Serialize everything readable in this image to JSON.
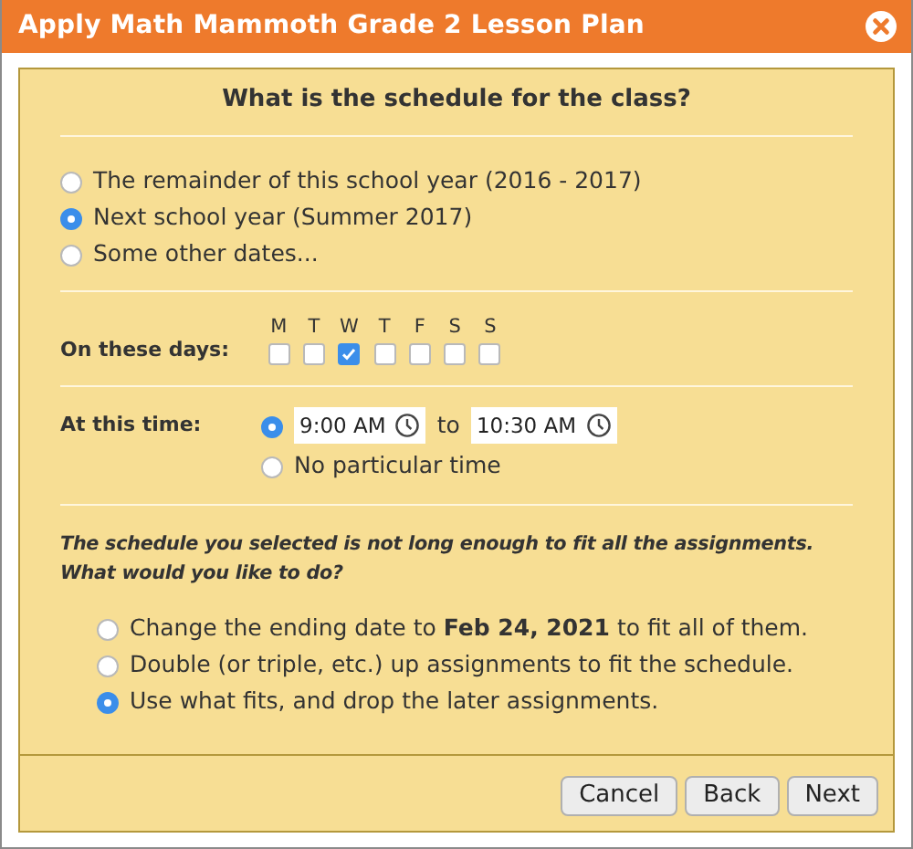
{
  "window": {
    "title": "Apply Math Mammoth Grade 2 Lesson Plan"
  },
  "question": "What is the schedule for the class?",
  "period_options": [
    {
      "label": "The remainder of this school year (2016 - 2017)",
      "selected": false
    },
    {
      "label": "Next school year (Summer 2017)",
      "selected": true
    },
    {
      "label": "Some other dates...",
      "selected": false
    }
  ],
  "days": {
    "label": "On these days:",
    "items": [
      {
        "letter": "M",
        "checked": false
      },
      {
        "letter": "T",
        "checked": false
      },
      {
        "letter": "W",
        "checked": true
      },
      {
        "letter": "T",
        "checked": false
      },
      {
        "letter": "F",
        "checked": false
      },
      {
        "letter": "S",
        "checked": false
      },
      {
        "letter": "S",
        "checked": false
      }
    ]
  },
  "time": {
    "label": "At this time:",
    "options": [
      {
        "kind": "range",
        "selected": true,
        "start": "9:00 AM",
        "separator": "to",
        "end": "10:30 AM"
      },
      {
        "kind": "none",
        "selected": false,
        "label": "No particular time"
      }
    ]
  },
  "warning_lines": [
    "The schedule you selected is not long enough to fit all the assignments.",
    "What would you like to do?"
  ],
  "fit_options": [
    {
      "label": "Change the ending date to **Feb 24, 2021** to fit all of them.",
      "selected": false
    },
    {
      "label": "Double (or triple, etc.) up assignments to fit the schedule.",
      "selected": false
    },
    {
      "label": "Use what fits, and drop the later assignments.",
      "selected": true
    }
  ],
  "buttons": [
    "Cancel",
    "Back",
    "Next"
  ]
}
